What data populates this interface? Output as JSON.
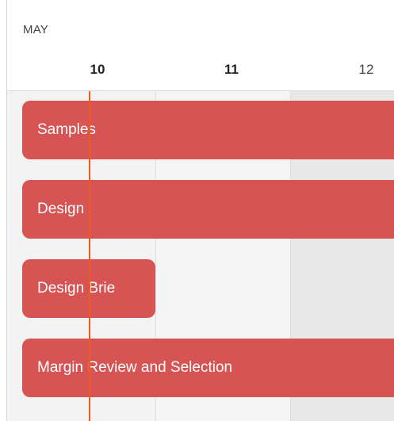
{
  "header": {
    "month": "MAY",
    "days": [
      {
        "label": "10",
        "today": true
      },
      {
        "label": "11",
        "today": false
      },
      {
        "label": "12",
        "today": false
      }
    ]
  },
  "tasks": [
    {
      "label": "Samples"
    },
    {
      "label": "Design"
    },
    {
      "label": "Design Brie"
    },
    {
      "label": "Margin Review and Selection"
    }
  ],
  "colors": {
    "task_bar": "#d65454",
    "now_line": "#f05a1a",
    "weekend_column": "#e8e8e8"
  }
}
